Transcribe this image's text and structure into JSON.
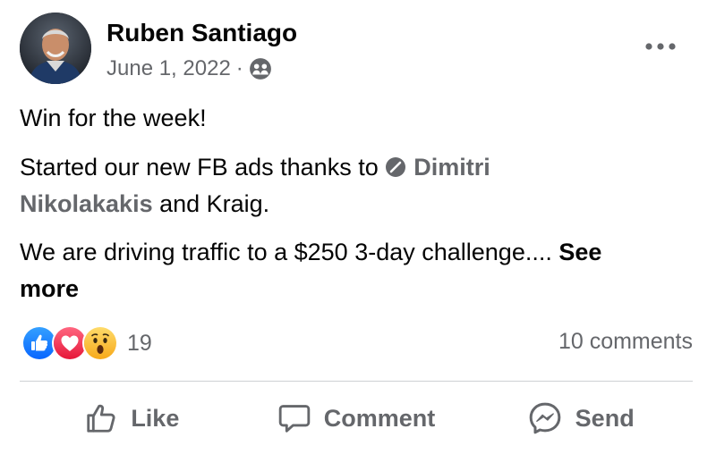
{
  "post": {
    "author": "Ruben Santiago",
    "date": "June 1, 2022",
    "separator": "·",
    "audience_icon": "friends-icon",
    "more_icon": "ellipsis-icon",
    "paragraph1": "Win for the week!",
    "paragraph2_prefix": "Started our new FB ads thanks to ",
    "mention1": "Dimitri",
    "mention1b": "Nikolakakis",
    "paragraph2_suffix": " and Kraig.",
    "paragraph3": "We are driving traffic to a $250 3-day challenge.... ",
    "see_more_1": "See",
    "see_more_2": "more"
  },
  "stats": {
    "reaction_icons": [
      "like-reaction-icon",
      "love-reaction-icon",
      "wow-reaction-icon"
    ],
    "reaction_count": "19",
    "comments": "10 comments"
  },
  "actions": [
    {
      "label": "Like",
      "icon": "thumbs-up-icon"
    },
    {
      "label": "Comment",
      "icon": "comment-icon"
    },
    {
      "label": "Send",
      "icon": "messenger-icon"
    }
  ],
  "colors": {
    "text": "#050505",
    "secondary": "#65676b",
    "like_blue": "#1877f2",
    "love_red": "#f33e58",
    "wow_yellow": "#f7b125",
    "divider": "#ced0d4"
  }
}
